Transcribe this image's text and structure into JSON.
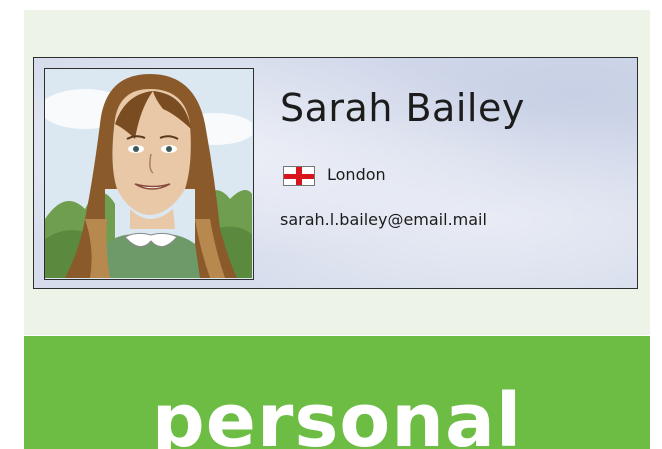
{
  "profile": {
    "name": "Sarah Bailey",
    "location": "London",
    "email": "sarah.l.bailey@email.mail",
    "flag_icon": "england-flag-icon",
    "portrait": "girl-portrait-illustration"
  },
  "banner": {
    "word": "personal",
    "color": "#6dbd44"
  },
  "colors": {
    "panel_background": "#eef3e8",
    "card_background": "#d6dcec",
    "flag_red": "#d9141c"
  }
}
